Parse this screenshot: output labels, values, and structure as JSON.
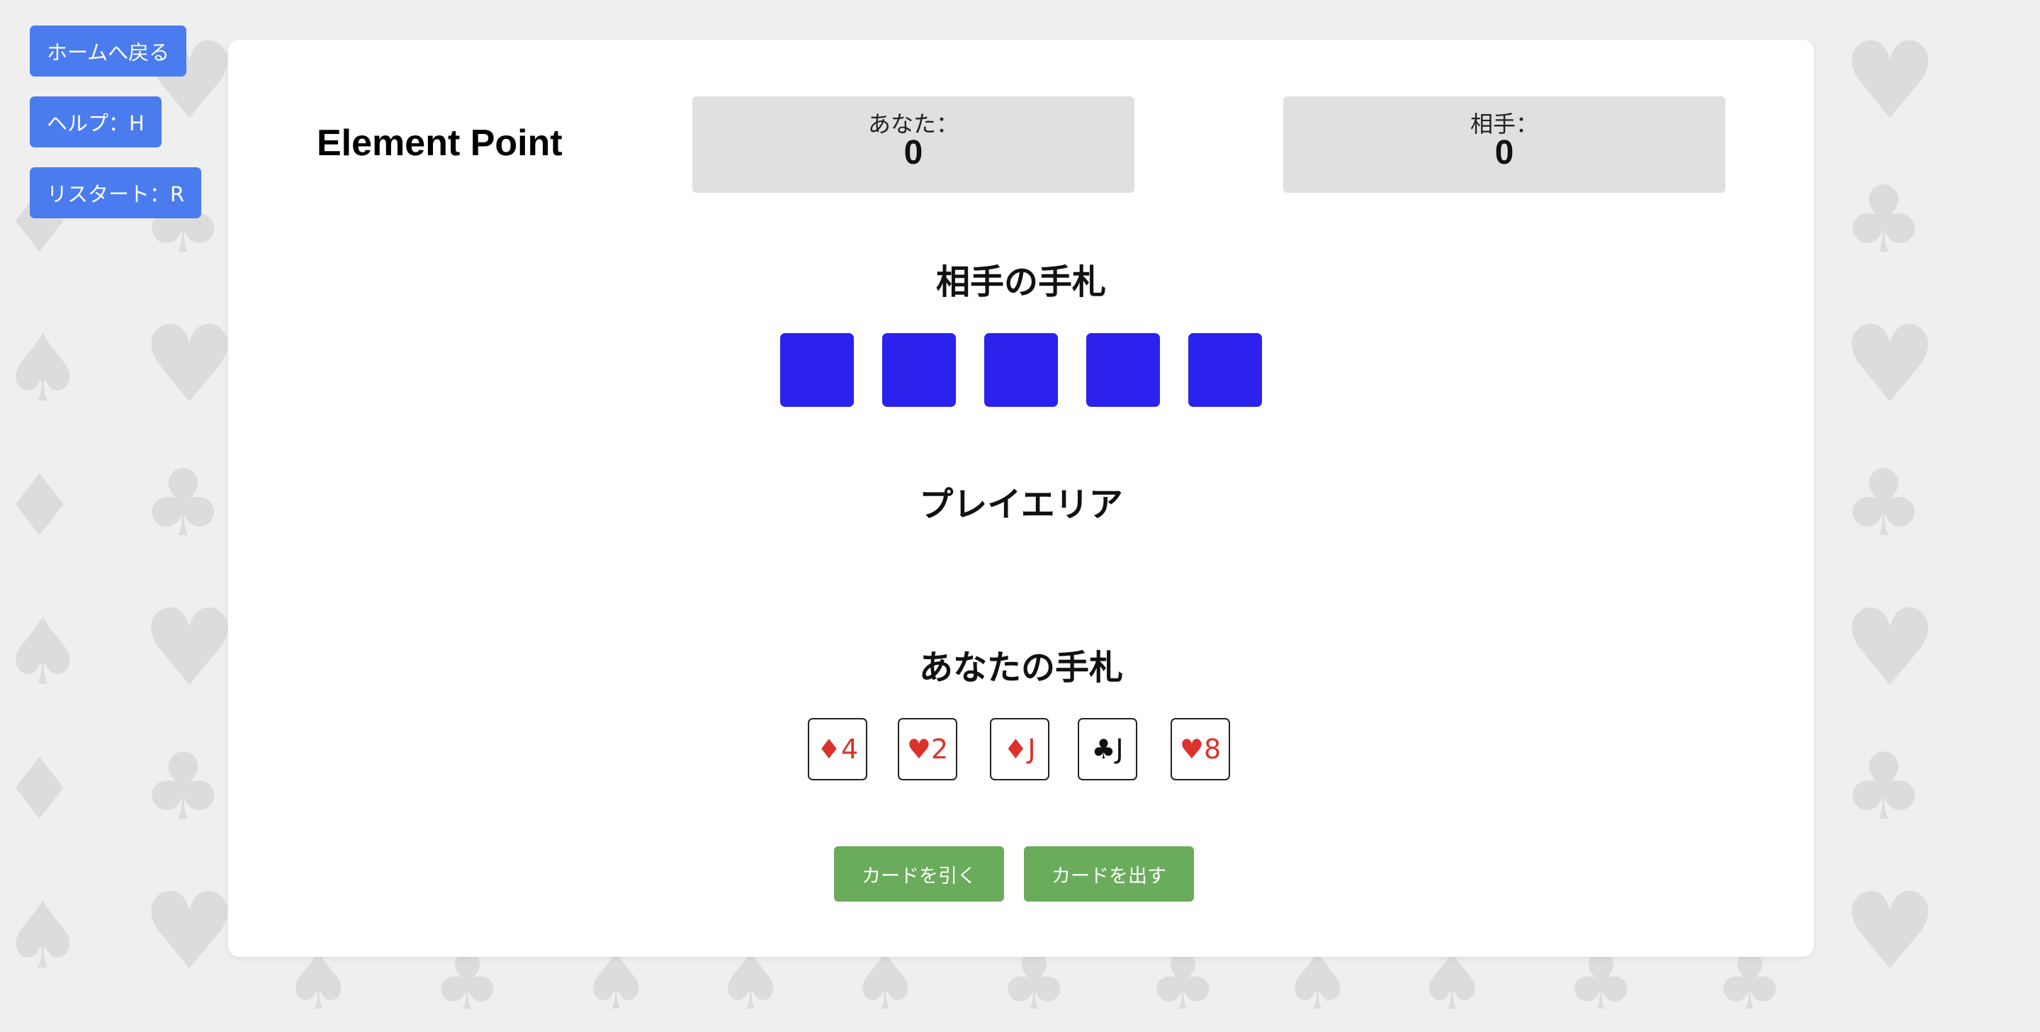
{
  "nav": {
    "home_label": "ホームへ戻る",
    "help_label": "ヘルプ：H",
    "restart_label": "リスタート：R"
  },
  "game": {
    "title": "Element Point"
  },
  "scores": {
    "player_label": "あなた：",
    "player_value": "0",
    "opponent_label": "相手：",
    "opponent_value": "0"
  },
  "sections": {
    "opponent_hand_title": "相手の手札",
    "play_area_title": "プレイエリア",
    "player_hand_title": "あなたの手札"
  },
  "opponent_hand": {
    "card_count": 5,
    "card_back_color": "#2b22ee"
  },
  "player_hand": {
    "cards": [
      {
        "suit": "♦",
        "rank": "4",
        "color": "red"
      },
      {
        "suit": "♥",
        "rank": "2",
        "color": "red"
      },
      {
        "suit": "♦",
        "rank": "J",
        "color": "red"
      },
      {
        "suit": "♣",
        "rank": "J",
        "color": "black"
      },
      {
        "suit": "♥",
        "rank": "8",
        "color": "red"
      }
    ]
  },
  "actions": {
    "draw_label": "カードを引く",
    "play_label": "カードを出す"
  },
  "colors": {
    "nav_button": "#4a7cf0",
    "action_button": "#6aac5c",
    "red_suit": "#d9332b"
  }
}
